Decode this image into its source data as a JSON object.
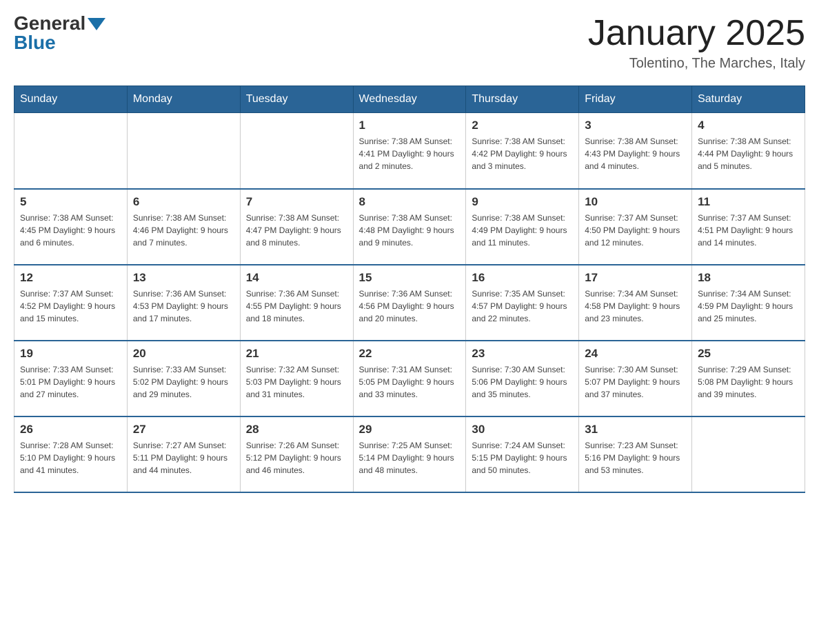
{
  "header": {
    "logo_general": "General",
    "logo_blue": "Blue",
    "month_title": "January 2025",
    "location": "Tolentino, The Marches, Italy"
  },
  "days_of_week": [
    "Sunday",
    "Monday",
    "Tuesday",
    "Wednesday",
    "Thursday",
    "Friday",
    "Saturday"
  ],
  "weeks": [
    [
      {
        "day": "",
        "info": ""
      },
      {
        "day": "",
        "info": ""
      },
      {
        "day": "",
        "info": ""
      },
      {
        "day": "1",
        "info": "Sunrise: 7:38 AM\nSunset: 4:41 PM\nDaylight: 9 hours and 2 minutes."
      },
      {
        "day": "2",
        "info": "Sunrise: 7:38 AM\nSunset: 4:42 PM\nDaylight: 9 hours and 3 minutes."
      },
      {
        "day": "3",
        "info": "Sunrise: 7:38 AM\nSunset: 4:43 PM\nDaylight: 9 hours and 4 minutes."
      },
      {
        "day": "4",
        "info": "Sunrise: 7:38 AM\nSunset: 4:44 PM\nDaylight: 9 hours and 5 minutes."
      }
    ],
    [
      {
        "day": "5",
        "info": "Sunrise: 7:38 AM\nSunset: 4:45 PM\nDaylight: 9 hours and 6 minutes."
      },
      {
        "day": "6",
        "info": "Sunrise: 7:38 AM\nSunset: 4:46 PM\nDaylight: 9 hours and 7 minutes."
      },
      {
        "day": "7",
        "info": "Sunrise: 7:38 AM\nSunset: 4:47 PM\nDaylight: 9 hours and 8 minutes."
      },
      {
        "day": "8",
        "info": "Sunrise: 7:38 AM\nSunset: 4:48 PM\nDaylight: 9 hours and 9 minutes."
      },
      {
        "day": "9",
        "info": "Sunrise: 7:38 AM\nSunset: 4:49 PM\nDaylight: 9 hours and 11 minutes."
      },
      {
        "day": "10",
        "info": "Sunrise: 7:37 AM\nSunset: 4:50 PM\nDaylight: 9 hours and 12 minutes."
      },
      {
        "day": "11",
        "info": "Sunrise: 7:37 AM\nSunset: 4:51 PM\nDaylight: 9 hours and 14 minutes."
      }
    ],
    [
      {
        "day": "12",
        "info": "Sunrise: 7:37 AM\nSunset: 4:52 PM\nDaylight: 9 hours and 15 minutes."
      },
      {
        "day": "13",
        "info": "Sunrise: 7:36 AM\nSunset: 4:53 PM\nDaylight: 9 hours and 17 minutes."
      },
      {
        "day": "14",
        "info": "Sunrise: 7:36 AM\nSunset: 4:55 PM\nDaylight: 9 hours and 18 minutes."
      },
      {
        "day": "15",
        "info": "Sunrise: 7:36 AM\nSunset: 4:56 PM\nDaylight: 9 hours and 20 minutes."
      },
      {
        "day": "16",
        "info": "Sunrise: 7:35 AM\nSunset: 4:57 PM\nDaylight: 9 hours and 22 minutes."
      },
      {
        "day": "17",
        "info": "Sunrise: 7:34 AM\nSunset: 4:58 PM\nDaylight: 9 hours and 23 minutes."
      },
      {
        "day": "18",
        "info": "Sunrise: 7:34 AM\nSunset: 4:59 PM\nDaylight: 9 hours and 25 minutes."
      }
    ],
    [
      {
        "day": "19",
        "info": "Sunrise: 7:33 AM\nSunset: 5:01 PM\nDaylight: 9 hours and 27 minutes."
      },
      {
        "day": "20",
        "info": "Sunrise: 7:33 AM\nSunset: 5:02 PM\nDaylight: 9 hours and 29 minutes."
      },
      {
        "day": "21",
        "info": "Sunrise: 7:32 AM\nSunset: 5:03 PM\nDaylight: 9 hours and 31 minutes."
      },
      {
        "day": "22",
        "info": "Sunrise: 7:31 AM\nSunset: 5:05 PM\nDaylight: 9 hours and 33 minutes."
      },
      {
        "day": "23",
        "info": "Sunrise: 7:30 AM\nSunset: 5:06 PM\nDaylight: 9 hours and 35 minutes."
      },
      {
        "day": "24",
        "info": "Sunrise: 7:30 AM\nSunset: 5:07 PM\nDaylight: 9 hours and 37 minutes."
      },
      {
        "day": "25",
        "info": "Sunrise: 7:29 AM\nSunset: 5:08 PM\nDaylight: 9 hours and 39 minutes."
      }
    ],
    [
      {
        "day": "26",
        "info": "Sunrise: 7:28 AM\nSunset: 5:10 PM\nDaylight: 9 hours and 41 minutes."
      },
      {
        "day": "27",
        "info": "Sunrise: 7:27 AM\nSunset: 5:11 PM\nDaylight: 9 hours and 44 minutes."
      },
      {
        "day": "28",
        "info": "Sunrise: 7:26 AM\nSunset: 5:12 PM\nDaylight: 9 hours and 46 minutes."
      },
      {
        "day": "29",
        "info": "Sunrise: 7:25 AM\nSunset: 5:14 PM\nDaylight: 9 hours and 48 minutes."
      },
      {
        "day": "30",
        "info": "Sunrise: 7:24 AM\nSunset: 5:15 PM\nDaylight: 9 hours and 50 minutes."
      },
      {
        "day": "31",
        "info": "Sunrise: 7:23 AM\nSunset: 5:16 PM\nDaylight: 9 hours and 53 minutes."
      },
      {
        "day": "",
        "info": ""
      }
    ]
  ]
}
